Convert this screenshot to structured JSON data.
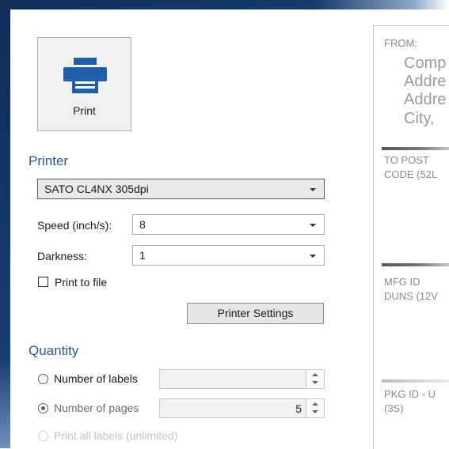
{
  "print_button": {
    "label": "Print",
    "icon": "printer-icon"
  },
  "printer": {
    "title": "Printer",
    "selected_printer": "SATO CL4NX 305dpi",
    "speed_label": "Speed (inch/s):",
    "speed_value": "8",
    "darkness_label": "Darkness:",
    "darkness_value": "1",
    "print_to_file_label": "Print to file",
    "print_to_file_checked": false,
    "settings_button": "Printer Settings"
  },
  "quantity": {
    "title": "Quantity",
    "options": [
      {
        "label": "Number of labels",
        "selected": false,
        "value": ""
      },
      {
        "label": "Number of pages",
        "selected": true,
        "value": "5"
      },
      {
        "label": "Print all labels (unlimited)",
        "selected": false,
        "enabled": false
      }
    ]
  },
  "preview": {
    "from_label": "FROM:",
    "from_lines": [
      "Comp",
      "Addre",
      "Addre",
      "City,"
    ],
    "to_line1": "TO POST",
    "to_line2": "CODE (52L",
    "mfg_line1": "MFG ID",
    "mfg_line2": "DUNS (12V",
    "pkg_line1": "PKG ID - U",
    "pkg_line2": "(3S)"
  },
  "colors": {
    "accent": "#2b5797",
    "frame": "#0f2d57"
  }
}
